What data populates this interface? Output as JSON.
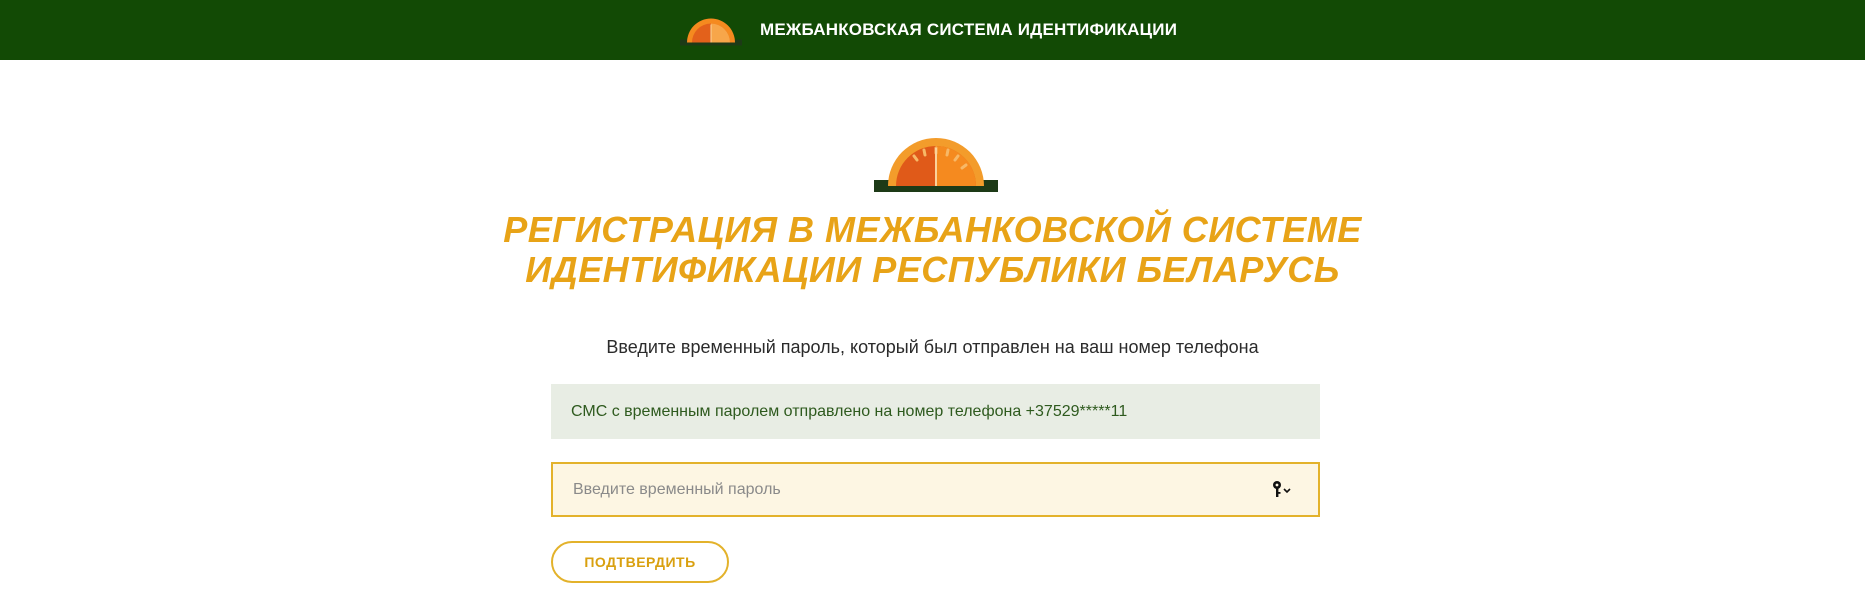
{
  "header": {
    "title": "МЕЖБАНКОВСКАЯ СИСТЕМА ИДЕНТИФИКАЦИИ",
    "logo_icon": "sun-gauge-logo-icon",
    "background_color": "#124a05"
  },
  "main": {
    "logo_icon": "sun-gauge-logo-icon",
    "title": "РЕГИСТРАЦИЯ В МЕЖБАНКОВСКОЙ СИСТЕМЕ ИДЕНТИФИКАЦИИ РЕСПУБЛИКИ БЕЛАРУСЬ",
    "instruction": "Введите временный пароль, который был отправлен на ваш номер телефона",
    "info_message": "СМС с временным паролем отправлено на номер телефона +37529*****11",
    "password_field": {
      "value": "",
      "placeholder": "Введите временный пароль",
      "icon": "key-icon"
    },
    "confirm_label": "ПОДТВЕРДИТЬ"
  },
  "colors": {
    "accent": "#e8a317",
    "header_green": "#124a05",
    "info_bg": "#e8ede4",
    "field_bg": "#fdf6e3"
  }
}
